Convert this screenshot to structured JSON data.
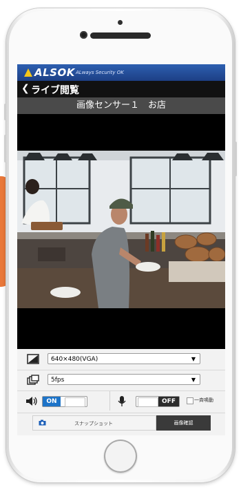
{
  "app": {
    "brand": "ALSOK",
    "tagline": "ALways Security OK",
    "back_label": "ライブ閲覧",
    "subtitle": "画像センサー１　お店"
  },
  "controls": {
    "resolution": {
      "selected": "640×480(VGA)"
    },
    "framerate": {
      "selected": "5fps"
    },
    "speaker": {
      "state_label": "ON",
      "state": true
    },
    "microphone": {
      "state_label": "OFF",
      "state": false
    },
    "broadcast_checkbox": {
      "label": "一斉鳴動",
      "checked": false
    }
  },
  "tabs": [
    {
      "label": "スナップショット",
      "active": false
    },
    {
      "label": "画像確認",
      "active": true
    }
  ],
  "colors": {
    "brand_blue": "#1d3f85",
    "toggle_on": "#1c73c8",
    "orange_tab": "#e9783a",
    "logo_yellow": "#f3c51a"
  },
  "icons": {
    "back": "chevron-left-icon",
    "resolution": "resolution-icon",
    "framerate": "frames-icon",
    "speaker": "speaker-icon",
    "microphone": "microphone-icon",
    "snapshot": "camera-icon"
  }
}
